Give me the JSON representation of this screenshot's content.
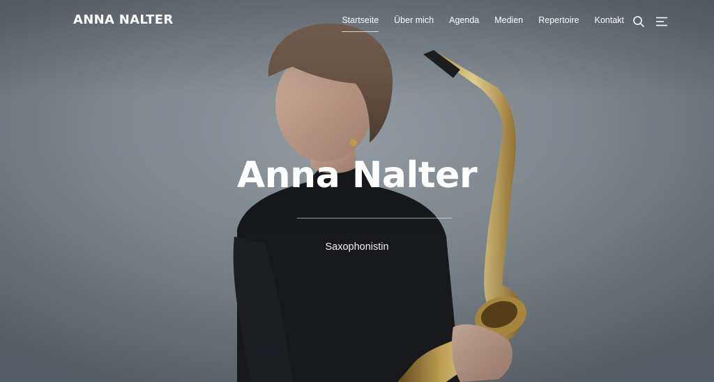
{
  "site": {
    "title": "ANNA NALTER"
  },
  "nav": {
    "items": [
      {
        "label": "Startseite",
        "active": true
      },
      {
        "label": "Über mich",
        "active": false
      },
      {
        "label": "Agenda",
        "active": false
      },
      {
        "label": "Medien",
        "active": false
      },
      {
        "label": "Repertoire",
        "active": false
      },
      {
        "label": "Kontakt",
        "active": false
      }
    ],
    "search_icon": "search-icon",
    "menu_icon": "menu-icon"
  },
  "hero": {
    "title": "Anna Nalter",
    "subtitle": "Saxophonistin"
  },
  "colors": {
    "text": "#ffffff",
    "background": "#7b838a"
  }
}
